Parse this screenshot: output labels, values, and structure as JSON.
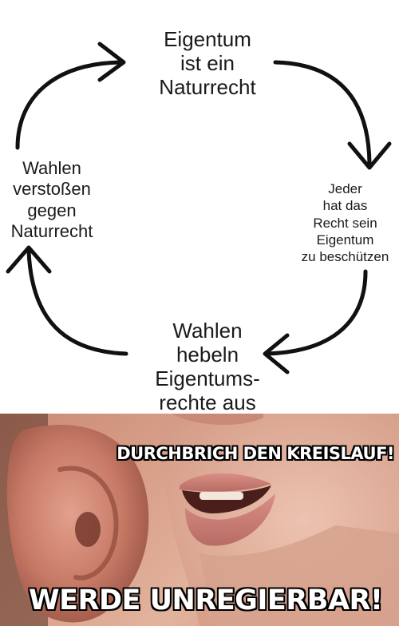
{
  "cycle": {
    "top_node": [
      "Eigentum",
      "ist ein",
      "Naturrecht"
    ],
    "right_node": [
      "Jeder",
      "hat das",
      "Recht sein",
      "Eigentum",
      "zu beschützen"
    ],
    "bottom_node": [
      "Wahlen",
      "hebeln",
      "Eigentums-",
      "rechte aus"
    ],
    "left_node": [
      "Wahlen",
      "verstoßen",
      "gegen",
      "Naturrecht"
    ]
  },
  "whisper": {
    "caption_top": "DURCHBRICH DEN KREISLAUF!",
    "caption_bottom": "WERDE UNREGIERBAR!"
  },
  "colors": {
    "arrow": "#111111",
    "caption_fill": "#ffffff",
    "caption_outline": "#000000",
    "skin": "#d9a08a"
  }
}
